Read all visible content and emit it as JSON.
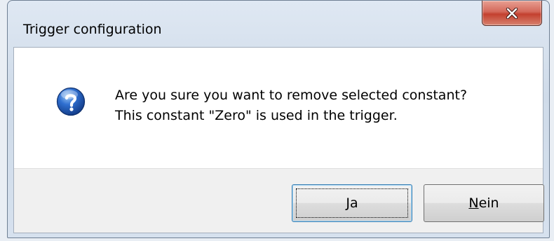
{
  "window": {
    "title": "Trigger configuration",
    "close_icon": "close-icon"
  },
  "dialog": {
    "icon": "question-icon",
    "message_line1": "Are you sure you want to remove selected constant?",
    "message_line2": "This constant \"Zero\" is used in the trigger."
  },
  "buttons": {
    "yes": {
      "mnemonic": "J",
      "rest": "a",
      "default": true
    },
    "no": {
      "mnemonic": "N",
      "rest": "ein",
      "default": false
    }
  }
}
